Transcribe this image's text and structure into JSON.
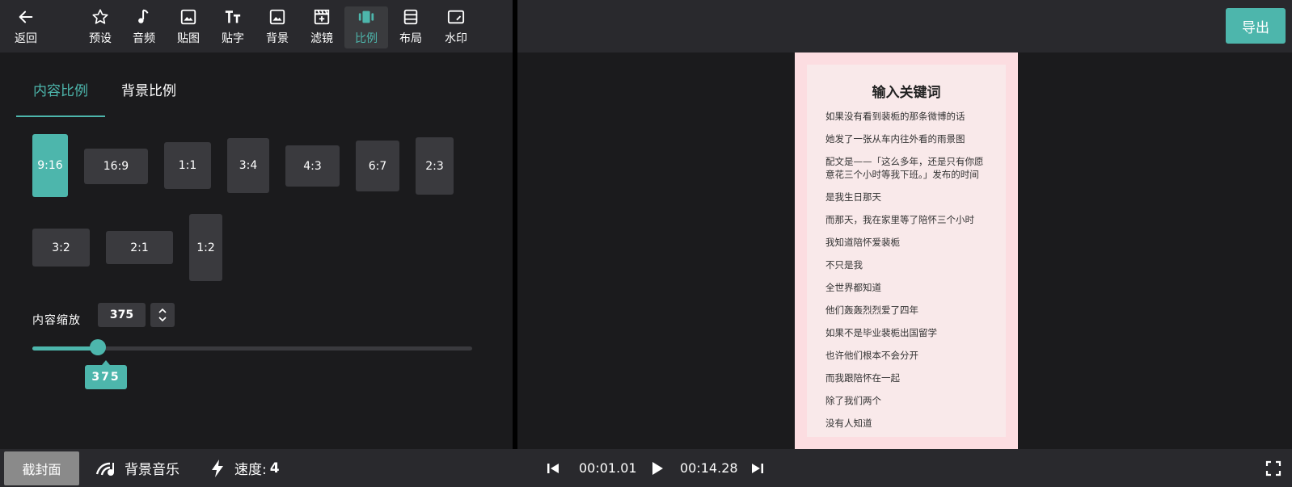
{
  "toolbar": {
    "back": "返回",
    "preset": "预设",
    "audio": "音频",
    "sticker": "贴图",
    "text": "贴字",
    "background": "背景",
    "filter": "滤镜",
    "ratio": "比例",
    "layout": "布局",
    "watermark": "水印"
  },
  "export_label": "导出",
  "tabs": {
    "content_ratio": "内容比例",
    "bg_ratio": "背景比例"
  },
  "ratios": [
    "9:16",
    "16:9",
    "1:1",
    "3:4",
    "4:3",
    "6:7",
    "2:3",
    "3:2",
    "2:1",
    "1:2"
  ],
  "selected_ratio": "9:16",
  "scale": {
    "label": "内容缩放",
    "value": "375",
    "fraction": 0.15
  },
  "preview": {
    "title": "输入关键词",
    "lines": [
      "如果没有看到裴栀的那条微博的话",
      "她发了一张从车内往外看的雨景图",
      "配文是——「这么多年，还是只有你愿意花三个小时等我下班。」发布的时间",
      "是我生日那天",
      "而那天，我在家里等了陪怀三个小时",
      "我知道陪怀爱裴栀",
      "不只是我",
      "全世界都知道",
      "他们轰轰烈烈爱了四年",
      "如果不是毕业裴栀出国留学",
      "也许他们根本不会分开",
      "而我跟陪怀在一起",
      "除了我们两个",
      "没有人知道"
    ]
  },
  "bottom": {
    "cover": "截封面",
    "bgm": "背景音乐",
    "speed_label": "速度:",
    "speed_value": "4",
    "current_time": "00:01.01",
    "total_time": "00:14.28"
  },
  "colors": {
    "accent": "#4db6ac",
    "panel": "#29292d",
    "button": "#3a3a3e"
  }
}
